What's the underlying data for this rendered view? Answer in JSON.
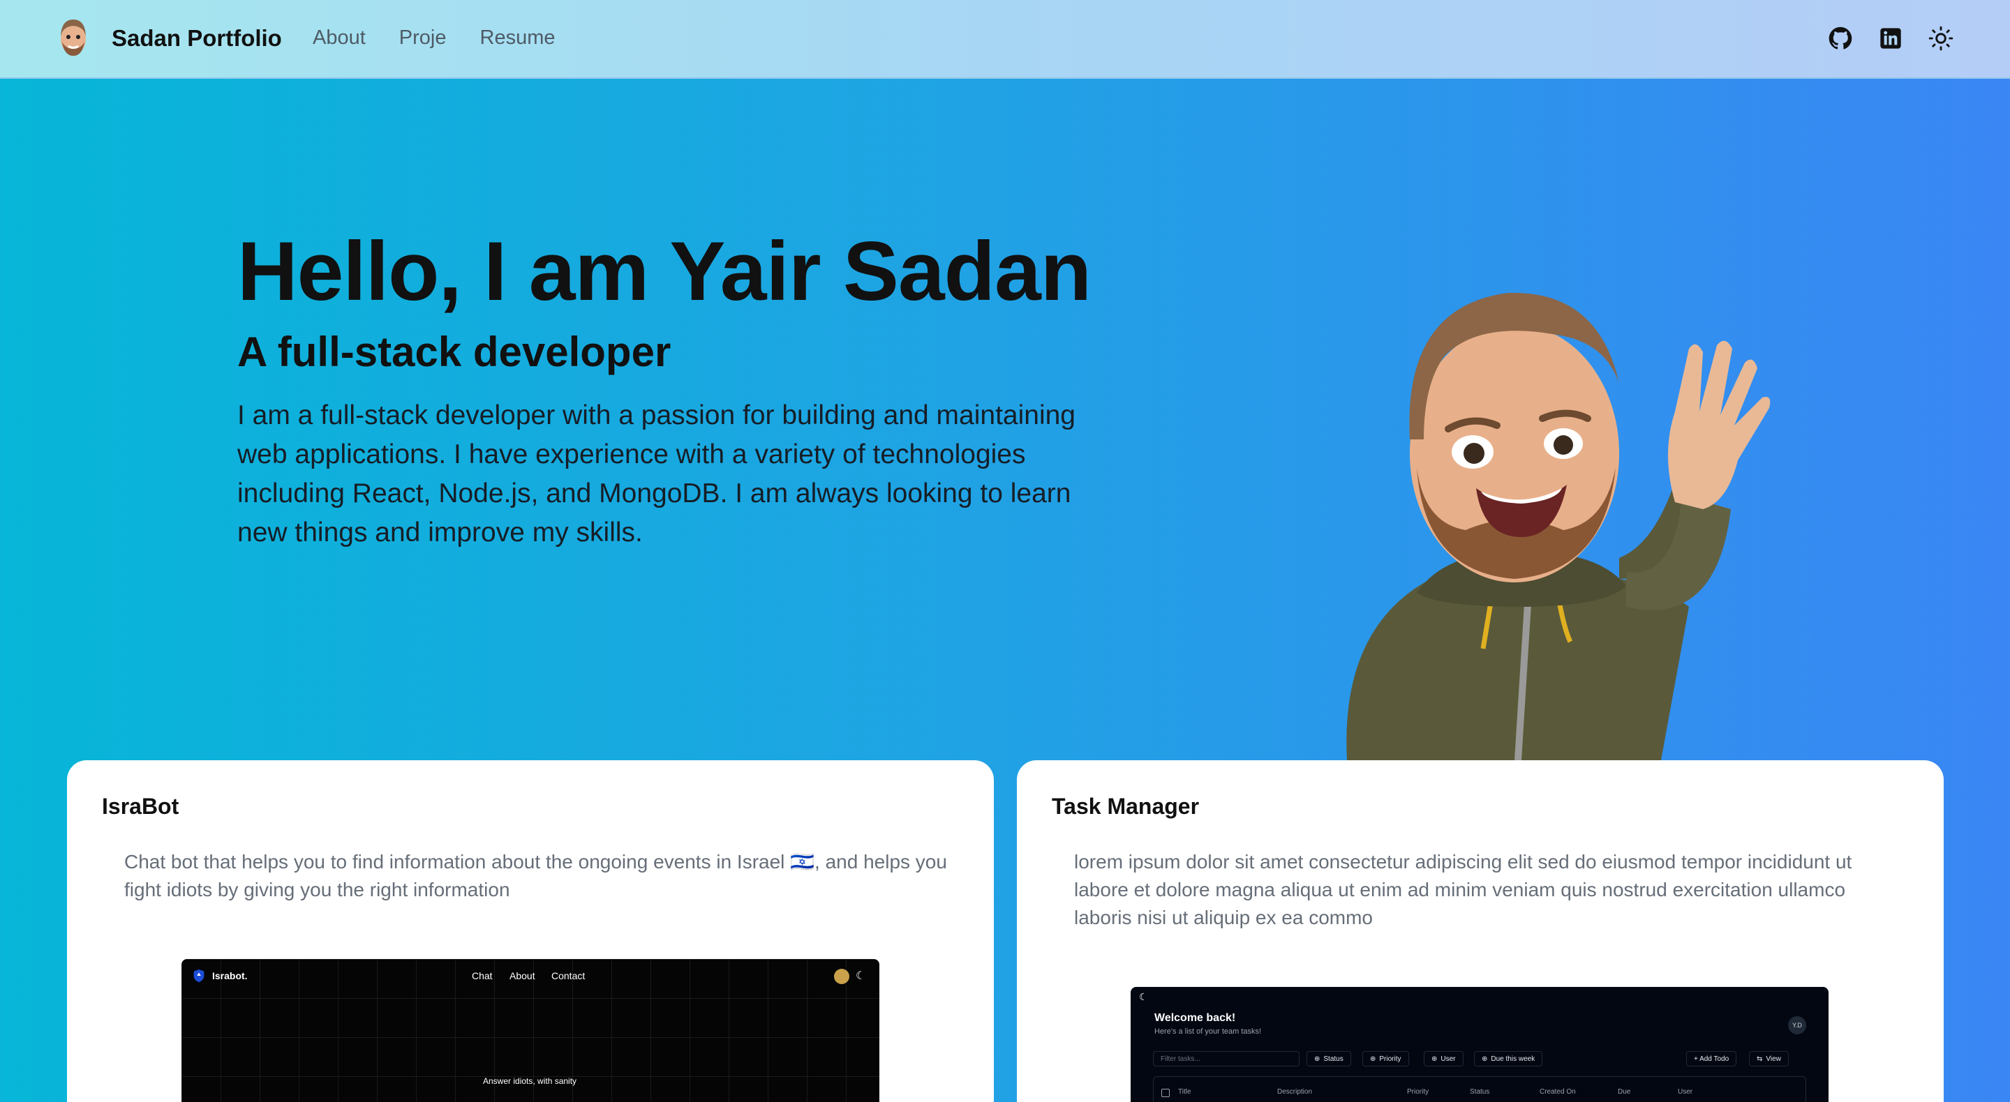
{
  "nav": {
    "brand": "Sadan Portfolio",
    "links": [
      "About",
      "Proje",
      "Resume"
    ],
    "icons": [
      "github-icon",
      "linkedin-icon",
      "sun-icon"
    ]
  },
  "hero": {
    "title": "Hello, I am Yair Sadan",
    "subtitle": "A full-stack developer",
    "body": "I am a full-stack developer with a passion for building and maintaining web applications. I have experience with a variety of technologies including React, Node.js, and MongoDB. I am always looking to learn new things and improve my skills."
  },
  "projects": [
    {
      "title": "IsraBot",
      "description": "Chat bot that helps you to find information about the ongoing events in Israel 🇮🇱, and helps you fight idiots by giving you the right information",
      "preview": {
        "brand": "Israbot.",
        "links": [
          "Chat",
          "About",
          "Contact"
        ],
        "tagline": "Answer idiots, with sanity"
      }
    },
    {
      "title": "Task Manager",
      "description": "lorem ipsum dolor sit amet consectetur adipiscing elit sed do eiusmod tempor incididunt ut labore et dolore magna aliqua ut enim ad minim veniam quis nostrud exercitation ullamco laboris nisi ut aliquip ex ea commo",
      "preview": {
        "heading": "Welcome back!",
        "subheading": "Here's a list of your team tasks!",
        "avatar": "Y.D",
        "filter_placeholder": "Filter tasks...",
        "filters": [
          "Status",
          "Priority",
          "User",
          "Due this week"
        ],
        "actions": [
          "+ Add Todo",
          "View"
        ],
        "columns": [
          "Title",
          "Description",
          "Priority",
          "Status",
          "Created On",
          "Due",
          "User"
        ]
      }
    }
  ],
  "colors": {
    "gradient_start": "#07b6d8",
    "gradient_end": "#3a86f4",
    "card_bg": "#ffffff"
  }
}
